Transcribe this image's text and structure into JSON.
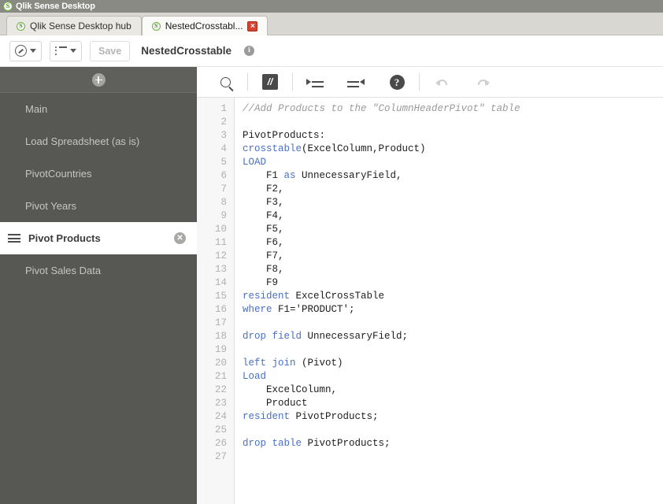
{
  "window": {
    "title": "Qlik Sense Desktop",
    "logo_icon": "qlik-logo-icon"
  },
  "tabs": [
    {
      "label": "Qlik Sense Desktop hub",
      "active": false,
      "closable": false,
      "icon": "qlik-logo-icon"
    },
    {
      "label": "NestedCrosstabl...",
      "active": true,
      "closable": true,
      "close_glyph": "×",
      "icon": "qlik-logo-icon"
    }
  ],
  "app_toolbar": {
    "nav_button": {
      "name": "navigation-dropdown",
      "icon": "compass-icon"
    },
    "sheet_button": {
      "name": "sheet-list-dropdown",
      "icon": "list-icon"
    },
    "save_label": "Save",
    "save_enabled": false,
    "app_title": "NestedCrosstable",
    "info_glyph": "i"
  },
  "sidebar": {
    "add_button": {
      "name": "add-section-button",
      "icon": "plus-circle-icon"
    },
    "items": [
      {
        "label": "Main",
        "selected": false
      },
      {
        "label": "Load Spreadsheet (as is)",
        "selected": false
      },
      {
        "label": "PivotCountries",
        "selected": false
      },
      {
        "label": "Pivot Years",
        "selected": false
      },
      {
        "label": "Pivot Products",
        "selected": true
      },
      {
        "label": "Pivot Sales Data",
        "selected": false
      }
    ],
    "selected_row": {
      "drag_icon": "drag-handle-icon",
      "delete_glyph": "✕",
      "delete_icon": "delete-circle-icon"
    }
  },
  "editor_toolbar": {
    "buttons": [
      {
        "name": "search-button",
        "icon": "search-icon"
      },
      {
        "name": "comment-button",
        "icon": "comment-icon",
        "glyph": "//"
      },
      {
        "name": "indent-right-button",
        "icon": "indent-right-icon"
      },
      {
        "name": "indent-left-button",
        "icon": "indent-left-icon"
      },
      {
        "name": "help-button",
        "icon": "help-icon",
        "glyph": "?"
      },
      {
        "name": "undo-button",
        "icon": "undo-icon",
        "enabled": false
      },
      {
        "name": "redo-button",
        "icon": "redo-icon",
        "enabled": false
      }
    ]
  },
  "editor": {
    "line_numbers": [
      1,
      2,
      3,
      4,
      5,
      6,
      7,
      8,
      9,
      10,
      11,
      12,
      13,
      14,
      15,
      16,
      17,
      18,
      19,
      20,
      21,
      22,
      23,
      24,
      25,
      26,
      27
    ],
    "lines": [
      {
        "segments": [
          {
            "t": "//Add Products to the \"ColumnHeaderPivot\" table",
            "c": "cm"
          }
        ]
      },
      {
        "segments": []
      },
      {
        "segments": [
          {
            "t": "PivotProducts:",
            "c": ""
          }
        ]
      },
      {
        "segments": [
          {
            "t": "crosstable",
            "c": "kw"
          },
          {
            "t": "(ExcelColumn,Product)",
            "c": ""
          }
        ]
      },
      {
        "segments": [
          {
            "t": "LOAD",
            "c": "kw"
          }
        ]
      },
      {
        "segments": [
          {
            "t": "    F1 ",
            "c": ""
          },
          {
            "t": "as",
            "c": "kw"
          },
          {
            "t": " UnnecessaryField,",
            "c": ""
          }
        ]
      },
      {
        "segments": [
          {
            "t": "    F2,",
            "c": ""
          }
        ]
      },
      {
        "segments": [
          {
            "t": "    F3,",
            "c": ""
          }
        ]
      },
      {
        "segments": [
          {
            "t": "    F4,",
            "c": ""
          }
        ]
      },
      {
        "segments": [
          {
            "t": "    F5,",
            "c": ""
          }
        ]
      },
      {
        "segments": [
          {
            "t": "    F6,",
            "c": ""
          }
        ]
      },
      {
        "segments": [
          {
            "t": "    F7,",
            "c": ""
          }
        ]
      },
      {
        "segments": [
          {
            "t": "    F8,",
            "c": ""
          }
        ]
      },
      {
        "segments": [
          {
            "t": "    F9",
            "c": ""
          }
        ]
      },
      {
        "segments": [
          {
            "t": "resident",
            "c": "kw"
          },
          {
            "t": " ExcelCrossTable",
            "c": ""
          }
        ]
      },
      {
        "segments": [
          {
            "t": "where",
            "c": "kw"
          },
          {
            "t": " F1='PRODUCT';",
            "c": ""
          }
        ]
      },
      {
        "segments": []
      },
      {
        "segments": [
          {
            "t": "drop field",
            "c": "kw"
          },
          {
            "t": " UnnecessaryField;",
            "c": ""
          }
        ]
      },
      {
        "segments": []
      },
      {
        "segments": [
          {
            "t": "left join",
            "c": "kw"
          },
          {
            "t": " (Pivot)",
            "c": ""
          }
        ]
      },
      {
        "segments": [
          {
            "t": "Load",
            "c": "kw"
          }
        ]
      },
      {
        "segments": [
          {
            "t": "    ExcelColumn,",
            "c": ""
          }
        ]
      },
      {
        "segments": [
          {
            "t": "    Product",
            "c": ""
          }
        ]
      },
      {
        "segments": [
          {
            "t": "resident",
            "c": "kw"
          },
          {
            "t": " PivotProducts;",
            "c": ""
          }
        ]
      },
      {
        "segments": []
      },
      {
        "segments": [
          {
            "t": "drop table",
            "c": "kw"
          },
          {
            "t": " PivotProducts;",
            "c": ""
          }
        ]
      },
      {
        "segments": []
      }
    ]
  },
  "colors": {
    "titlebar": "#8a8a84",
    "tabstrip": "#d8d7d1",
    "sidebar": "#575754",
    "keyword": "#4a6fc4",
    "comment": "#9a9a9a",
    "accent_green": "#6cb33f",
    "close_red": "#d44231"
  }
}
